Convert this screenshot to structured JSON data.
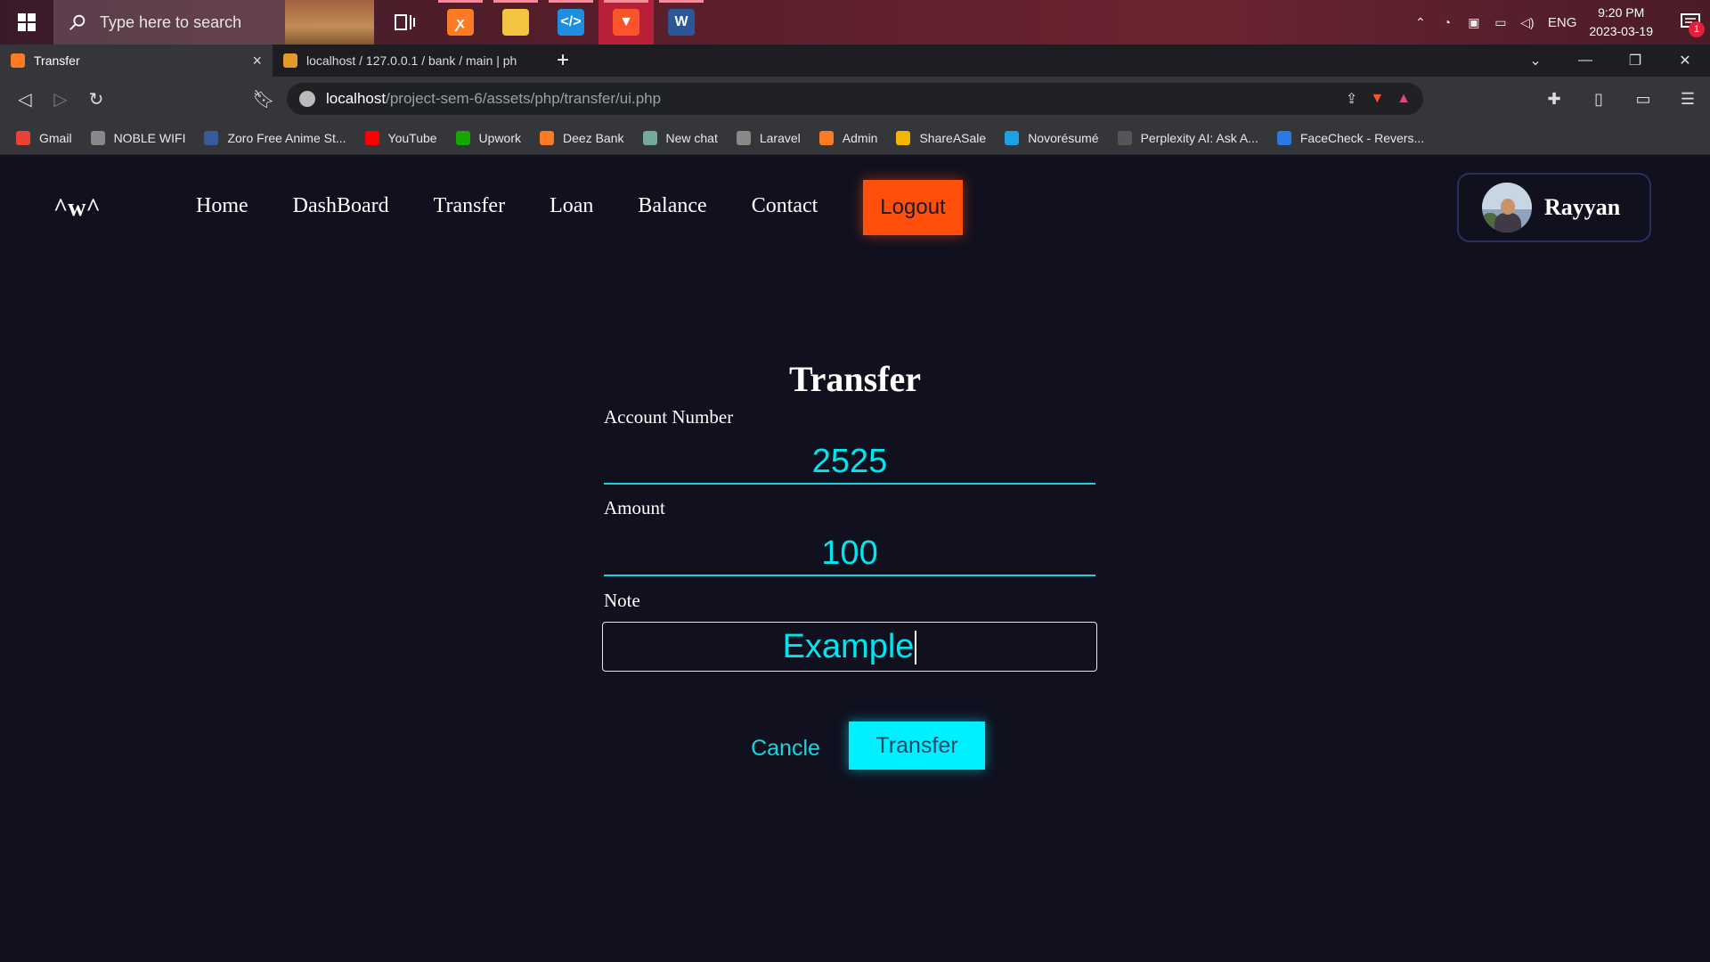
{
  "taskbar": {
    "search_placeholder": "Type here to search",
    "language": "ENG",
    "time": "9:20 PM",
    "date": "2023-03-19",
    "notification_count": "1",
    "apps": [
      "task-view",
      "xampp",
      "file-explorer",
      "vscode",
      "brave",
      "word"
    ]
  },
  "browser": {
    "tabs": [
      {
        "title": "Transfer",
        "active": true
      },
      {
        "title": "localhost / 127.0.0.1 / bank / main | ph",
        "active": false
      }
    ],
    "url_host": "localhost",
    "url_path": "/project-sem-6/assets/php/transfer/ui.php",
    "bookmarks": [
      {
        "label": "Gmail",
        "icon": "gmail-icon",
        "color": "#ea4335"
      },
      {
        "label": "NOBLE WIFI",
        "icon": "globe-icon",
        "color": "#888888"
      },
      {
        "label": "Zoro Free Anime St...",
        "icon": "zoro-icon",
        "color": "#3a5a9a"
      },
      {
        "label": "YouTube",
        "icon": "youtube-icon",
        "color": "#ff0000"
      },
      {
        "label": "Upwork",
        "icon": "upwork-icon",
        "color": "#14a800"
      },
      {
        "label": "Deez Bank",
        "icon": "xampp-icon",
        "color": "#fb7a24"
      },
      {
        "label": "New chat",
        "icon": "chatgpt-icon",
        "color": "#74aa9c"
      },
      {
        "label": "Laravel",
        "icon": "globe-icon",
        "color": "#888888"
      },
      {
        "label": "Admin",
        "icon": "xampp-icon",
        "color": "#fb7a24"
      },
      {
        "label": "ShareASale",
        "icon": "star-icon",
        "color": "#f4b400"
      },
      {
        "label": "Novorésumé",
        "icon": "novoresume-icon",
        "color": "#1ea0e6"
      },
      {
        "label": "Perplexity AI: Ask A...",
        "icon": "grid-icon",
        "color": "#555555"
      },
      {
        "label": "FaceCheck - Revers...",
        "icon": "shield-icon",
        "color": "#2a7ae2"
      }
    ]
  },
  "site": {
    "logo": "^w^",
    "nav": [
      "Home",
      "DashBoard",
      "Transfer",
      "Loan",
      "Balance",
      "Contact"
    ],
    "logout_label": "Logout",
    "user_name": "Rayyan"
  },
  "form": {
    "title": "Transfer",
    "account_label": "Account Number",
    "account_value": "2525",
    "amount_label": "Amount",
    "amount_value": "100",
    "note_label": "Note",
    "note_value": "Example",
    "cancel_label": "Cancle",
    "submit_label": "Transfer"
  },
  "colors": {
    "page_bg": "#10101f",
    "accent_cyan": "#00f0ff",
    "logout_orange": "#ff4f0a"
  }
}
